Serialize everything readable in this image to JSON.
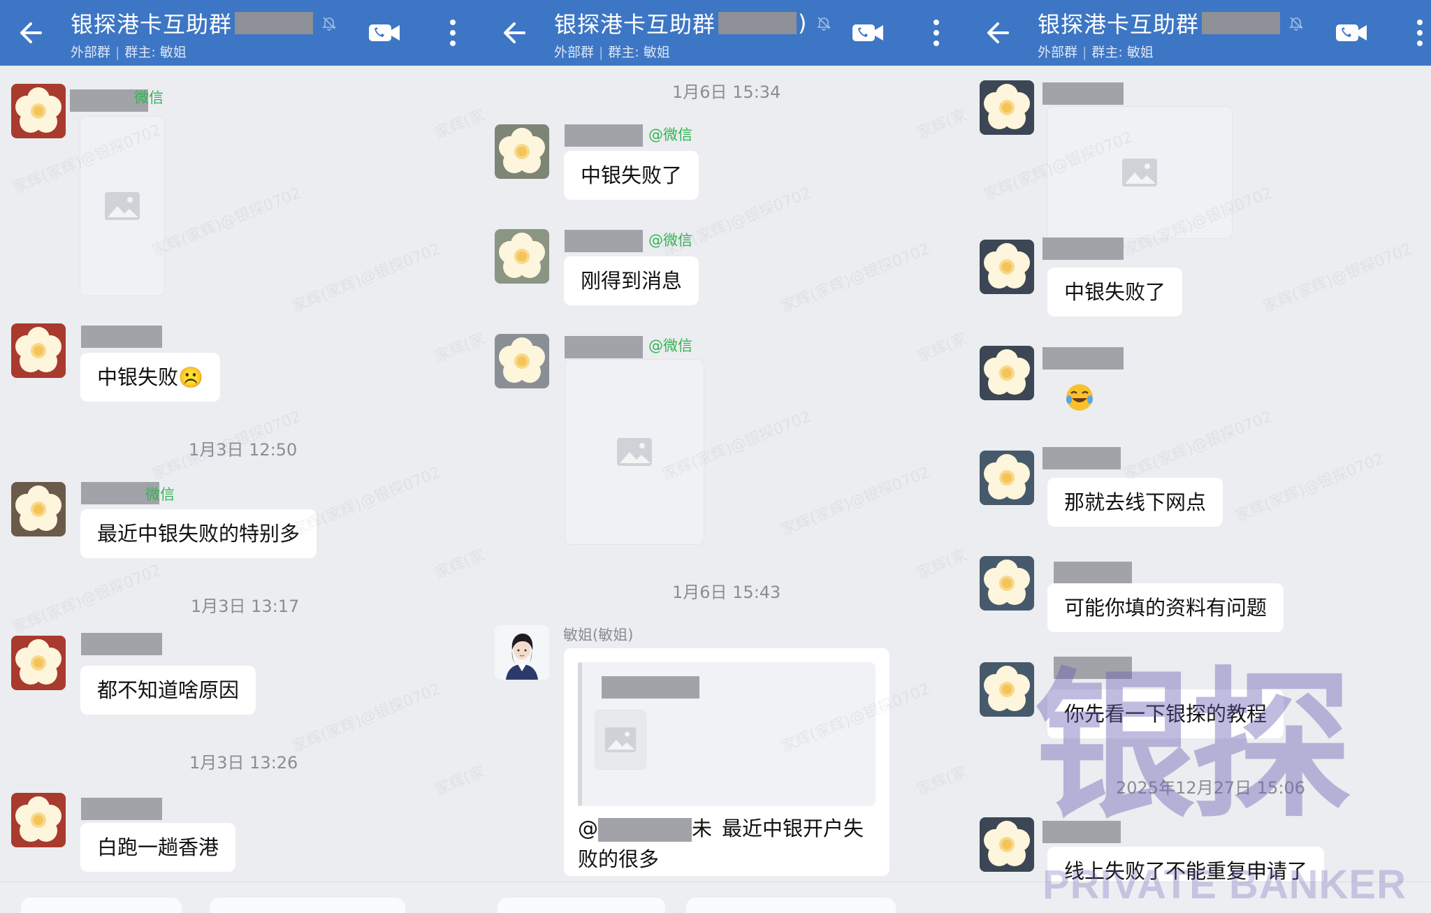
{
  "panels": [
    {
      "header": {
        "title": "银探港卡互助群",
        "subtitle_left": "外部群",
        "subtitle_sep": "|",
        "subtitle_right": "群主: 敏姐"
      },
      "messages": [
        {
          "type": "image",
          "sender_suffix": "微信"
        },
        {
          "type": "text",
          "text": "中银失败☹️"
        },
        {
          "type": "time",
          "text": "1月3日 12:50"
        },
        {
          "type": "text",
          "sender_suffix": "微信",
          "text": "最近中银失败的特别多"
        },
        {
          "type": "time",
          "text": "1月3日 13:17"
        },
        {
          "type": "text",
          "text": "都不知道啥原因"
        },
        {
          "type": "time",
          "text": "1月3日 13:26"
        },
        {
          "type": "text",
          "text": "白跑一趟香港"
        }
      ]
    },
    {
      "header": {
        "title": "银探港卡互助群",
        "title_suffix": ")",
        "subtitle_left": "外部群",
        "subtitle_sep": "|",
        "subtitle_right": "群主: 敏姐"
      },
      "messages": [
        {
          "type": "time",
          "text": "1月6日 15:34"
        },
        {
          "type": "text",
          "sender_suffix": "@微信",
          "text": "中银失败了"
        },
        {
          "type": "text",
          "sender_suffix": "@微信",
          "text": "刚得到消息"
        },
        {
          "type": "image",
          "sender_suffix": "@微信"
        },
        {
          "type": "time",
          "text": "1月6日 15:43"
        },
        {
          "type": "quote",
          "sender_name": "敏姐(敏姐)",
          "at_prefix": "@",
          "at_suffix": "未",
          "text_line1": "最近中银开户失",
          "text_line2": "败的很多"
        }
      ]
    },
    {
      "header": {
        "title": "银探港卡互助群",
        "subtitle_left": "外部群",
        "subtitle_sep": "|",
        "subtitle_right": "群主: 敏姐"
      },
      "messages": [
        {
          "type": "image"
        },
        {
          "type": "text",
          "text": "中银失败了"
        },
        {
          "type": "emoji",
          "text": "😂"
        },
        {
          "type": "text",
          "text": "那就去线下网点"
        },
        {
          "type": "text",
          "text": "可能你填的资料有问题"
        },
        {
          "type": "text",
          "text": "你先看一下银探的教程"
        },
        {
          "type": "time",
          "text": "2025年12月27日 15:06"
        },
        {
          "type": "text",
          "text": "线上失败了不能重复申请了"
        }
      ]
    }
  ],
  "watermark": {
    "repeat_text": "家辉(家辉)@银探0702",
    "repeat_short": "家辉(家",
    "brand_cn": "银探",
    "brand_en": "PRIVATE BANKER"
  },
  "icons": {
    "back": "arrow-left-icon",
    "mute": "bell-muted-icon",
    "video": "video-call-icon",
    "more": "more-vertical-icon",
    "image_placeholder": "image-placeholder-icon",
    "avatar_flower": "flower-avatar-icon",
    "avatar_woman": "woman-avatar-icon"
  },
  "colors": {
    "header_bg": "#3d76c4",
    "sender_green": "#34b352",
    "chat_bg": "#ebedf0",
    "bubble_bg": "#ffffff",
    "watermark_purple": "#6a5fb5"
  }
}
